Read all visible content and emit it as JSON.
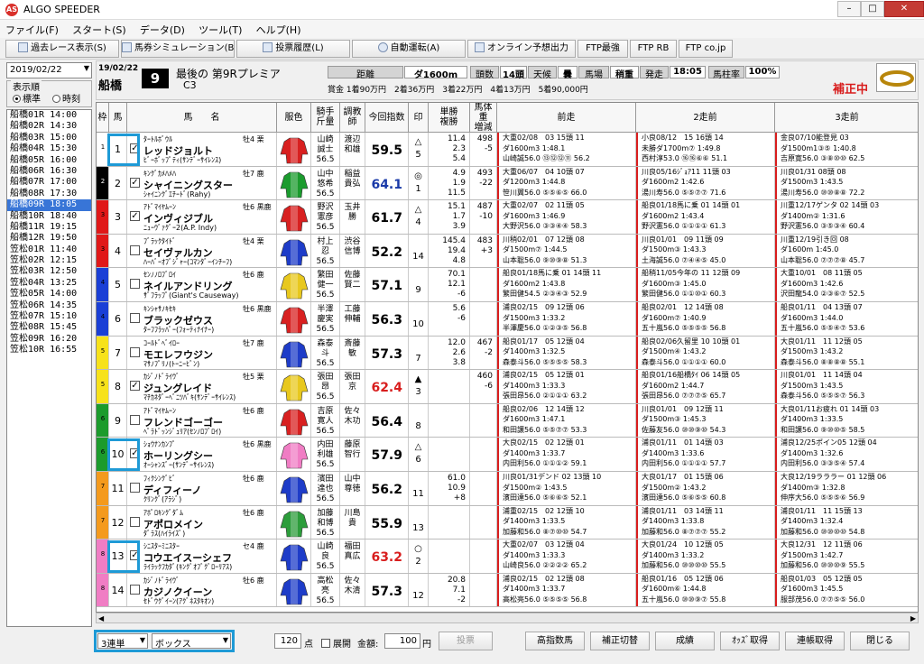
{
  "window": {
    "title": "ALGO SPEEDER",
    "minimize": "–",
    "maximize": "□",
    "close": "✕"
  },
  "menu": [
    "ファイル(F)",
    "スタート(S)",
    "データ(D)",
    "ツール(T)",
    "ヘルプ(H)"
  ],
  "toolbar": {
    "past_race": "過去レース表示(S)",
    "sim": "馬券シミュレーション(B)",
    "history": "投票履歴(L)",
    "auto": "自動運転(A)",
    "online": "オンライン予想出力",
    "ftp_best": "FTP最強",
    "ftp_rb": "FTP RB",
    "ftp_co": "FTP co.jp"
  },
  "left": {
    "date": "2019/02/22",
    "sort_label": "表示順",
    "sort_std": "標準",
    "sort_time": "時刻",
    "races": [
      "船橋01R 14:00",
      "船橋02R 14:30",
      "船橋03R 15:00",
      "船橋04R 15:30",
      "船橋05R 16:00",
      "船橋06R 16:30",
      "船橋07R 17:00",
      "船橋08R 17:30",
      "船橋09R 18:05",
      "船橋10R 18:40",
      "船橋11R 19:15",
      "船橋12R 19:50",
      "笠松01R 11:40",
      "笠松02R 12:15",
      "笠松03R 12:50",
      "笠松04R 13:25",
      "笠松05R 14:00",
      "笠松06R 14:35",
      "笠松07R 15:10",
      "笠松08R 15:45",
      "笠松09R 16:20",
      "笠松10R 16:55"
    ],
    "selected": 8
  },
  "race": {
    "date": "19/02/22",
    "venue": "船橋",
    "number": "9",
    "name": "最後の 第9Rプレミア",
    "class": "C3",
    "dist_label": "距離",
    "dist": "ダ1600m",
    "count_label": "頭数",
    "count": "14頭",
    "weather_label": "天候",
    "weather": "曇",
    "track_label": "馬場",
    "track": "稍重",
    "start_label": "発走",
    "start": "18:05",
    "rate_label": "馬柱率",
    "rate": "100%",
    "prize": "賞金 1着90万円　2着36万円　3着22万円　4着13万円　5着90,000円",
    "status": "補正中"
  },
  "columns": [
    "枠",
    "馬",
    "馬　　名",
    "服色",
    "騎手\n斤量",
    "調教師",
    "今回指数",
    "印",
    "単勝\n複勝",
    "馬体重\n増減",
    "前走",
    "2走前",
    "3走前"
  ],
  "horses": [
    {
      "frame": "1",
      "no": "1",
      "checked": true,
      "sire": "ﾀｰﾄﾙﾎﾞｳﾙ",
      "name": "レッドジョルト",
      "dam": "ﾋﾞｰﾎﾞｯﾌﾟﾃｨ(ｻﾝﾃﾞｰｻｲﾚﾝｽ)",
      "sex": "牡4 栗",
      "jockey": "山崎\n誠士\n56.5",
      "trainer": "渡辺\n和雄",
      "index": "59.5",
      "mark": "△\n5",
      "odds": "11.4\n2.3\n5.4",
      "weight": "498\n-5",
      "p1": [
        "大重02/08　03 15頭 11",
        "ダ1600m3 1:48.1",
        "山崎誠56.0 ⑬⑫⑫⑪ 56.2"
      ],
      "p2": [
        "小良08/12　15 16頭 14",
        "未勝ダ1700m⑦ 1:49.8",
        "西村淳53.0 ⑯⑯⑥⑥ 51.1"
      ],
      "p3": [
        "金良07/10能登見 03",
        "ダ1500m1③⑤ 1:40.8",
        "吉原寛56.0 ③⑧⑩⑩ 62.5"
      ]
    },
    {
      "frame": "2",
      "no": "2",
      "checked": true,
      "sire": "ｷﾝｸﾞｶﾒﾊﾒﾊ",
      "name": "シャイニングスター",
      "dam": "ｼｬｲﾆﾝｸﾞｴﾁｰﾄﾞ(Rahy)",
      "sex": "牡7 鹿",
      "jockey": "山中\n悠希\n56.5",
      "trainer": "稲益\n貴弘",
      "index": "64.1",
      "mark": "◎\n1",
      "odds": "4.9\n1.9\n11.5",
      "weight": "493\n-22",
      "p1": [
        "大重06/07　04 10頭 07",
        "ダ1200m3 1:44.8",
        "笹川翼56.0 ⑤⑤⑥⑤ 66.0"
      ],
      "p2": [
        "川良05/16ｼﾞｮｱ11 11頭 03",
        "ダ1600m2 1:42.6",
        "湯川寿56.0 ⑤⑤⑦⑦ 71.6"
      ],
      "p3": [
        "川良01/31 08頭 08",
        "ダ1500m3 1:43.5",
        "湯川寿56.0 ⑩⑩⑧⑧ 72.2"
      ]
    },
    {
      "frame": "3",
      "no": "3",
      "checked": true,
      "sire": "ｱﾄﾞﾏｲﾔﾑｰﾝ",
      "name": "インヴィジブル",
      "dam": "ﾆｭｰｳﾞｧｸﾞｰ2(A.P. Indy)",
      "sex": "牡6 黒鹿",
      "jockey": "野沢\n憲彦\n56.5",
      "trainer": "玉井\n勝",
      "index": "61.7",
      "mark": "△\n4",
      "odds": "15.1\n1.7\n3.9",
      "weight": "487\n-10",
      "p1": [
        "大重02/07　02 11頭 05",
        "ダ1600m3 1:46.9",
        "大野沢56.0 ③③④④ 58.3"
      ],
      "p2": [
        "船良01/18馬に乗 01 14頭 01",
        "ダ1600m2 1:43.4",
        "野沢憲56.0 ①①①① 61.3"
      ],
      "p3": [
        "川重12/17ゲンタ 02 14頭 03",
        "ダ1400m② 1:31.6",
        "野沢憲56.0 ③⑤③④ 60.4"
      ]
    },
    {
      "frame": "3",
      "no": "4",
      "checked": false,
      "sire": "ﾌﾞﾗｯｸﾀｲﾄﾞ",
      "name": "セイヴァルカン",
      "dam": "ﾊｰﾊﾞｰｵﾌﾞｼﾞｬｰ(ｺﾏﾝﾀﾞｰｲﾝﾁｰﾌ)",
      "sex": "牡4 栗",
      "jockey": "村上\n忍\n56.5",
      "trainer": "渋谷\n信博",
      "index": "52.2",
      "mark": "\n14",
      "odds": "145.4\n19.4\n4.8",
      "weight": "483\n+3",
      "p1": [
        "川稍02/01　07 12頭 08",
        "ダ1500m⑦ 1:44.5",
        "山本聡56.0 ⑨⑩⑨⑧ 51.3"
      ],
      "p2": [
        "川良01/01　09 11頭 09",
        "ダ1500m③ 1:43.3",
        "土海誠56.0 ⑦④④⑤ 45.0"
      ],
      "p3": [
        "川重12/19引き回 08",
        "ダ1600m 1:45.0",
        "山本聡56.0 ⑦⑦⑦⑧ 45.7"
      ]
    },
    {
      "frame": "4",
      "no": "5",
      "checked": false,
      "sire": "ｾﾝﾉﾉﾛﾌﾞﾛｲ",
      "name": "ネイルアンドリング",
      "dam": "ｻﾞﾌﾗｯﾌﾟ(Giant's Causeway)",
      "sex": "牡6 鹿",
      "jockey": "繁田\n健一\n56.5",
      "trainer": "佐藤\n賢二",
      "index": "57.1",
      "mark": "\n9",
      "odds": "70.1\n12.1\n-6",
      "weight": "",
      "p1": [
        "船良01/18馬に乗 01 14頭 11",
        "ダ1600m2 1:43.8",
        "繁田健54.5 ②③④③ 52.9"
      ],
      "p2": [
        "船稍11/05今年の 11 12頭 09",
        "ダ1600m③ 1:45.0",
        "繁田健56.0 ①①⑩① 60.3"
      ],
      "p3": [
        "大重10/01　08 11頭 05",
        "ダ1600m3 1:42.6",
        "沢田龍54.0 ②③⑥⑦ 52.5"
      ]
    },
    {
      "frame": "4",
      "no": "6",
      "checked": false,
      "sire": "ｷﾝｼｬｻﾉｷｾｷ",
      "name": "ブラックゼウス",
      "dam": "ﾀｰﾌﾌﾗｯﾊﾟｰ(ﾌｫｰﾃｨﾅｲﾅｰ)",
      "sex": "牡6 黒鹿",
      "jockey": "半澤\n慶実\n56.5",
      "trainer": "工藤\n伸輔",
      "index": "56.3",
      "mark": "\n10",
      "odds": "5.6\n-6",
      "weight": "",
      "p1": [
        "浦良02/15　09 12頭 06",
        "ダ1500m3 1:33.2",
        "半澤慶56.0 ①②③⑤ 56.8"
      ],
      "p2": [
        "船良02/01　12 14頭 08",
        "ダ1600m⑦ 1:40.9",
        "五十嵐56.0 ⑤⑤⑤⑤ 56.8"
      ],
      "p3": [
        "船良01/11　04 13頭 07",
        "ダ1600m3 1:44.0",
        "五十嵐56.0 ⑤⑤④⑦ 53.6"
      ]
    },
    {
      "frame": "5",
      "no": "7",
      "checked": false,
      "sire": "ｺｰﾙﾄﾞﾍﾞｲﾛｰ",
      "name": "モエレフウジン",
      "dam": "ﾏｻﾉﾌﾟﾘﾉ(ﾄｰﾆｰﾋﾞﾝ)",
      "sex": "牡7 鹿",
      "jockey": "森泰\n斗\n56.5",
      "trainer": "斎藤\n敏",
      "index": "57.3",
      "mark": "\n7",
      "odds": "12.0\n2.6\n3.8",
      "weight": "467\n-2",
      "p1": [
        "船良01/17　05 12頭 04",
        "ダ1400m3 1:32.5",
        "森泰斗56.0 ⑤⑤⑤⑤ 58.3"
      ],
      "p2": [
        "船良02/06久留里 10 10頭 01",
        "ダ1500m④ 1:43.2",
        "森泰斗56.0 ①①①① 60.0"
      ],
      "p3": [
        "大良01/11　11 12頭 05",
        "ダ1500m3 1:43.2",
        "森泰斗56.0 ⑧⑧⑧⑧ 55.1"
      ]
    },
    {
      "frame": "5",
      "no": "8",
      "checked": true,
      "sire": "ｶｼﾞﾉﾄﾞﾗｲｳﾞ",
      "name": "ジュングレイド",
      "dam": "ﾏﾁｶﾈﾀﾞｰﾍﾞﾆﾂﾊﾞｷ(ｻﾝﾃﾞｰｻｲﾚﾝｽ)",
      "sex": "牡5 栗",
      "jockey": "張田\n昂\n56.5",
      "trainer": "張田\n京",
      "index": "62.4",
      "mark": "▲\n3",
      "odds": "",
      "weight": "460\n-6",
      "p1": [
        "浦良02/15　05 12頭 01",
        "ダ1400m3 1:33.3",
        "張田昂56.0 ②①①① 63.2"
      ],
      "p2": [
        "船良01/16船橋ﾀｲ 06 14頭 05",
        "ダ1600m2 1:44.7",
        "張田昂56.0 ⑦⑦⑦⑤ 65.7"
      ],
      "p3": [
        "川良01/01　11 14頭 04",
        "ダ1500m3 1:43.5",
        "森泰斗56.0 ⑤⑤⑤⑦ 56.3"
      ]
    },
    {
      "frame": "6",
      "no": "9",
      "checked": false,
      "sire": "ｱﾄﾞﾏｲﾔﾑｰﾝ",
      "name": "フレンドゴーゴー",
      "dam": "ﾍﾟﾗﾄﾞｯﾝｼﾞｭﾘｱ(ｾﾝﾉﾛﾌﾞﾛｲ)",
      "sex": "牡6 鹿",
      "jockey": "吉原\n寛人\n56.5",
      "trainer": "佐々\n木功",
      "index": "56.4",
      "mark": "\n8",
      "odds": "",
      "weight": "",
      "p1": [
        "船良02/06　12 14頭 12",
        "ダ1600m3 1:47.1",
        "和田譲56.0 ⑤⑤⑦⑦ 53.3"
      ],
      "p2": [
        "川良01/01　09 12頭 11",
        "ダ1500m③ 1:45.3",
        "佐藤友56.0 ⑩⑩⑨⑩ 54.3"
      ],
      "p3": [
        "大良01/11お疲れ 01 14頭 03",
        "ダ1400m3 1:33.5",
        "和田譲56.0 ⑨⑩⑩⑤ 58.5"
      ]
    },
    {
      "frame": "6",
      "no": "10",
      "checked": true,
      "sire": "ｼｮｳﾅﾝｶﾝﾌﾟ",
      "name": "ホーリングシー",
      "dam": "ｵｰｼｬﾝｽﾞｰ(ｻﾝﾃﾞｰｻｲﾚﾝｽ)",
      "sex": "牡6 黒鹿",
      "jockey": "内田\n利雄\n56.5",
      "trainer": "藤原\n智行",
      "index": "57.9",
      "mark": "△\n6",
      "odds": "",
      "weight": "",
      "p1": [
        "大良02/15　02 12頭 01",
        "ダ1400m3 1:33.7",
        "内田利56.0 ①①①② 59.1"
      ],
      "p2": [
        "浦良01/11　01 14頭 03",
        "ダ1400m3 1:33.6",
        "内田利56.0 ①①①① 57.7"
      ],
      "p3": [
        "浦良12/25ポイン05 12頭 04",
        "ダ1400m3 1:32.6",
        "内田利56.0 ③③⑤④ 57.4"
      ]
    },
    {
      "frame": "7",
      "no": "11",
      "checked": false,
      "sire": "ﾌｨｸｼﾝｸﾞﾋﾞ",
      "name": "ディフィーノ",
      "dam": "ｸﾘﾝｸﾞ(ｱﾗｼﾞ)",
      "sex": "牡6 鹿",
      "jockey": "濱田\n達也\n56.5",
      "trainer": "山中\n尊徳",
      "index": "56.2",
      "mark": "\n11",
      "odds": "61.0\n10.9\n+8",
      "weight": "",
      "p1": [
        "川良01/31デンド 02 13頭 10",
        "ダ1500m② 1:43.5",
        "濱田達56.0 ⑤⑥⑥⑤ 52.1"
      ],
      "p2": [
        "大良01/17　01 15頭 06",
        "ダ1500m② 1:43.2",
        "濱田達56.0 ⑤⑥⑤⑤ 60.8"
      ],
      "p3": [
        "大良12/19ラララー 01 12頭 06",
        "ダ1400m③ 1:32.8",
        "伸序大56.0 ⑤⑤⑤⑥ 56.9"
      ]
    },
    {
      "frame": "7",
      "no": "12",
      "checked": false,
      "sire": "ｱﾎﾟﾛｷﾝｸﾞﾀﾞﾑ",
      "name": "アポロメイン",
      "dam": "ﾀﾞﾗｽ(ﾊｲﾗｲｽﾞ)",
      "sex": "牡6 鹿",
      "jockey": "加藤\n和博\n56.5",
      "trainer": "川島\n貴",
      "index": "55.9",
      "mark": "\n13",
      "odds": "",
      "weight": "",
      "p1": [
        "浦重02/15　02 12頭 10",
        "ダ1400m3 1:33.5",
        "加藤和56.0 ⑧⑦⑩⑩ 54.7"
      ],
      "p2": [
        "浦良01/11　03 14頭 11",
        "ダ1400m3 1:33.8",
        "加藤和56.0 ⑧⑦⑦⑦ 55.2"
      ],
      "p3": [
        "浦良01/11　11 15頭 13",
        "ダ1400m3 1:32.4",
        "加藤和56.0 ⑩⑩⑩⑩ 54.8"
      ]
    },
    {
      "frame": "8",
      "no": "13",
      "checked": true,
      "sire": "ｼﾆｽﾀｰﾐﾆｽﾀｰ",
      "name": "コウエイスーシェフ",
      "dam": "ﾗｲﾗｯｸﾌｶﾀﾞ(ｷﾝｸﾞｵﾌﾞｸﾞﾛｰﾘｱｽ)",
      "sex": "セ4 鹿",
      "jockey": "山崎\n良\n56.5",
      "trainer": "福田\n真広",
      "index": "63.2",
      "mark": "○\n2",
      "odds": "",
      "weight": "",
      "p1": [
        "大重02/07　03 12頭 04",
        "ダ1400m3 1:33.3",
        "山崎良56.0 ②②②② 65.2"
      ],
      "p2": [
        "大良01/24　10 12頭 05",
        "ダ1400m3 1:33.2",
        "加藤和56.0 ⑩⑩⑩⑩ 55.5"
      ],
      "p3": [
        "大良12/31　12 11頭 06",
        "ダ1500m3 1:42.7",
        "加藤和56.0 ⑩⑩⑩⑨ 55.5"
      ]
    },
    {
      "frame": "8",
      "no": "14",
      "checked": false,
      "sire": "ｶｼﾞﾉﾄﾞﾗｲｳﾞ",
      "name": "カジノクイーン",
      "dam": "ｾﾄﾞｳｸﾞｲｰﾝ(ｱｸﾞﾈｽﾀｷｵﾝ)",
      "sex": "牡6 鹿",
      "jockey": "高松\n亮\n56.5",
      "trainer": "佐々\n木清",
      "index": "57.3",
      "mark": "\n12",
      "odds": "20.8\n7.1\n-2",
      "weight": "",
      "p1": [
        "浦良02/15　02 12頭 08",
        "ダ1400m3 1:33.7",
        "高松亮56.0 ⑤⑤⑤⑤ 56.8"
      ],
      "p2": [
        "船良01/16　05 12頭 06",
        "ダ1600m⑥ 1:44.8",
        "五十嵐56.0 ⑩⑩⑨⑦ 55.8"
      ],
      "p3": [
        "船良01/03　05 12頭 05",
        "ダ1600m3 1:45.5",
        "服部茂56.0 ⑦⑦⑤⑤ 56.0"
      ]
    }
  ],
  "bottom": {
    "bet_type": "3連単",
    "method": "ボックス",
    "points": "120",
    "points_unit": "点",
    "expand": "展開",
    "amount_label": "金額:",
    "amount": "100",
    "amount_unit": "円",
    "vote": "投票",
    "high_index": "高指数馬",
    "correction": "補正切替",
    "results": "成績",
    "odds": "ｵｯｽﾞ取得",
    "renpaku": "連帳取得",
    "close": "閉じる"
  },
  "frame_colors": [
    "#ffffff",
    "#000000",
    "#e01818",
    "#1a3fd6",
    "#f7e21a",
    "#1c9b2c",
    "#f49a1d",
    "#f07dc4"
  ]
}
